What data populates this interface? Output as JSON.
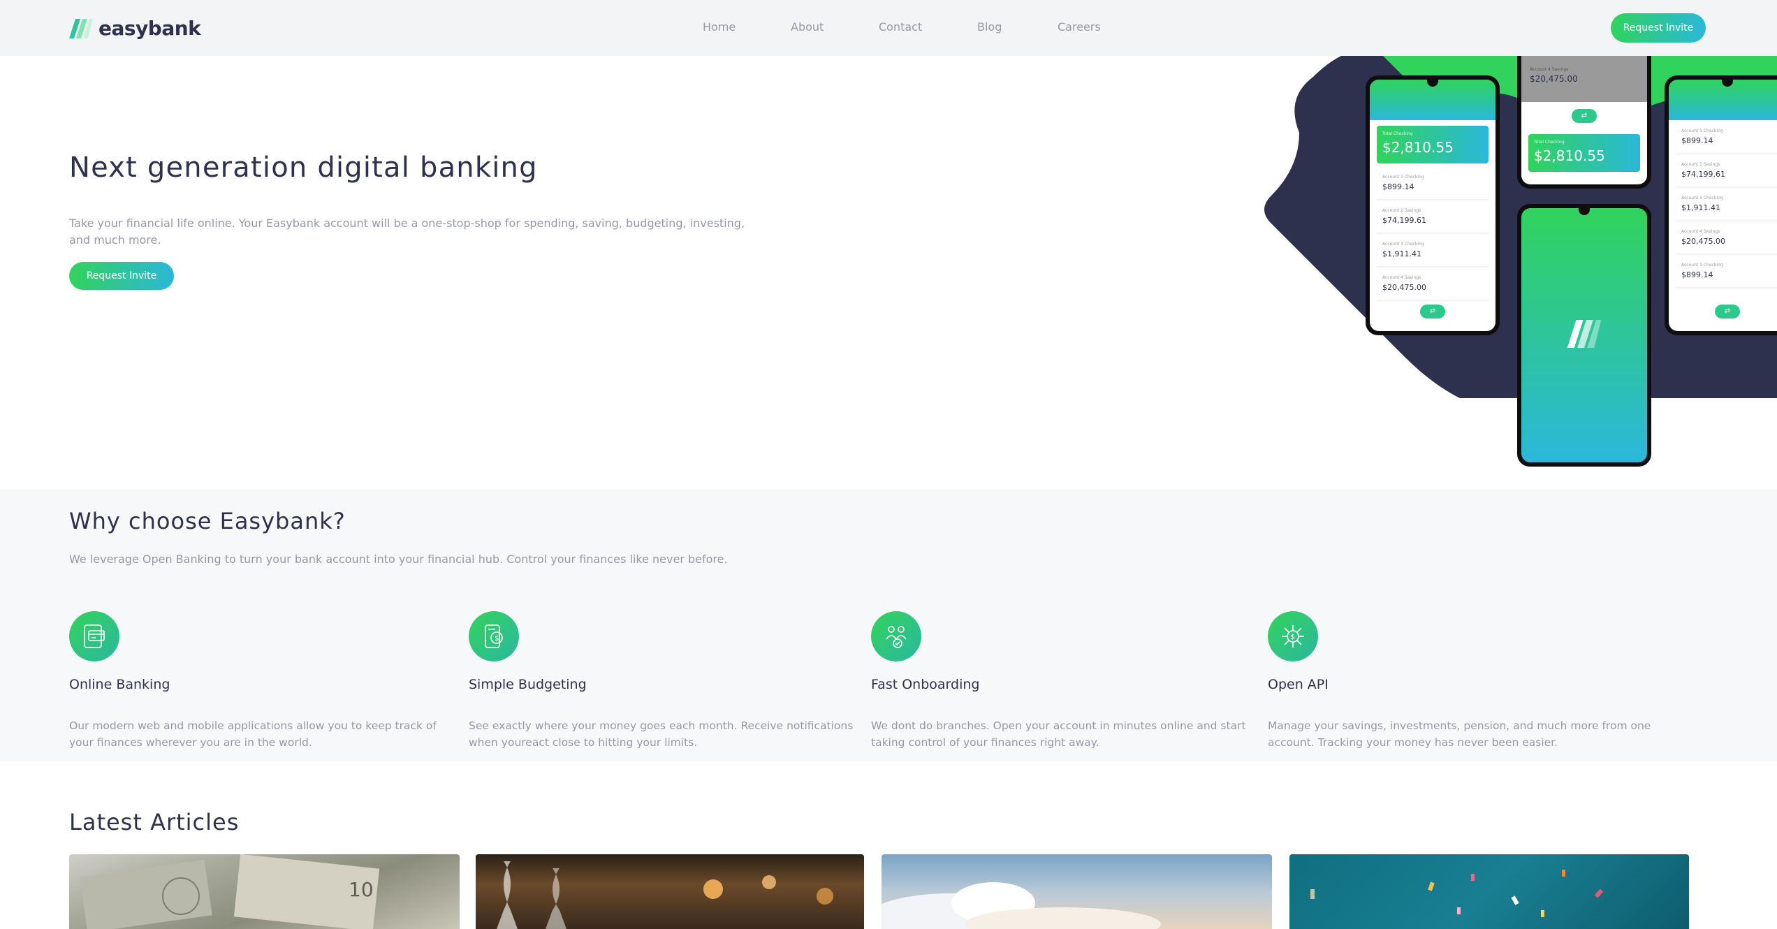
{
  "header": {
    "logo_text": "easybank",
    "nav": [
      "Home",
      "About",
      "Contact",
      "Blog",
      "Careers"
    ],
    "cta_label": "Request Invite"
  },
  "hero": {
    "title": "Next generation digital banking",
    "text": "Take your financial life online. Your Easybank account will be a one-stop-shop for spending, saving, budgeting, investing, and much more.",
    "cta_label": "Request Invite",
    "phones": {
      "left": {
        "card_label": "Total Checking",
        "card_value": "$2,810.55",
        "accounts": [
          {
            "label": "Account 1 Checking",
            "value": "$899.14"
          },
          {
            "label": "Account 2 Savings",
            "value": "$74,199.61"
          },
          {
            "label": "Account 3 Checking",
            "value": "$1,911.41"
          },
          {
            "label": "Account 4 Savings",
            "value": "$20,475.00"
          }
        ]
      },
      "top": {
        "top_label": "Account 4 Savings",
        "top_value": "$20,475.00",
        "card_label": "Total Checking",
        "card_value": "$2,810.55"
      },
      "right": {
        "accounts": [
          {
            "label": "Account 1 Checking",
            "value": "$899.14"
          },
          {
            "label": "Account 2 Savings",
            "value": "$74,199.61"
          },
          {
            "label": "Account 3 Checking",
            "value": "$1,911.41"
          },
          {
            "label": "Account 4 Savings",
            "value": "$20,475.00"
          },
          {
            "label": "Account 1 Checking",
            "value": "$899.14"
          }
        ]
      }
    }
  },
  "why": {
    "title": "Why choose Easybank?",
    "text": "We leverage Open Banking to turn your bank account into your financial hub. Control your finances like never before.",
    "features": [
      {
        "icon": "online-banking-icon",
        "title": "Online Banking",
        "text": "Our modern web and mobile applications allow you to keep track of your finances wherever you are in the world."
      },
      {
        "icon": "budgeting-icon",
        "title": "Simple Budgeting",
        "text": "See exactly where your money goes each month. Receive notifications when youreact close to hitting your limits."
      },
      {
        "icon": "onboarding-icon",
        "title": "Fast Onboarding",
        "text": "We dont do branches. Open your account in minutes online and start taking control of your finances right away."
      },
      {
        "icon": "api-icon",
        "title": "Open API",
        "text": "Manage your savings, investments, pension, and much more from one account. Tracking your money has never been easier."
      }
    ]
  },
  "articles": {
    "title": "Latest Articles"
  },
  "colors": {
    "dark_blue": "#2d314d",
    "lime_green": "#31d35c",
    "bright_cyan": "#2bb7da",
    "grayish_blue": "#9698a6",
    "light_bg": "#f7f8f9"
  }
}
